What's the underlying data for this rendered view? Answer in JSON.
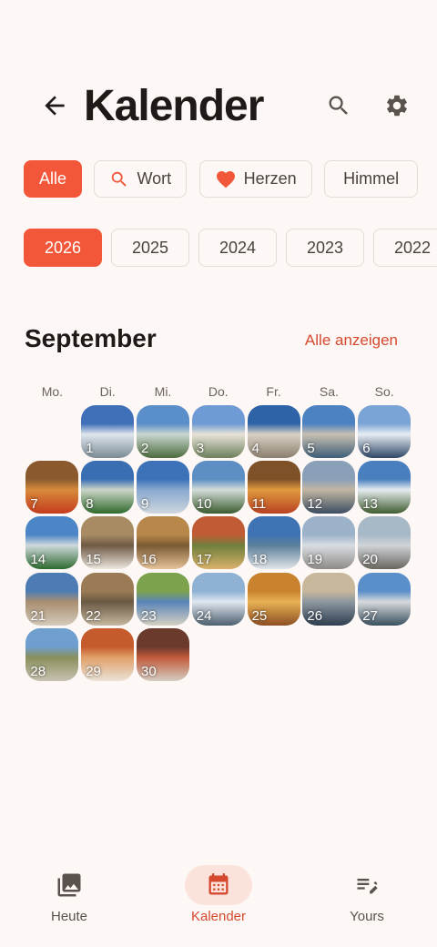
{
  "header": {
    "title": "Kalender"
  },
  "chips": [
    {
      "label": "Alle",
      "active": true,
      "icon": ""
    },
    {
      "label": "Wort",
      "active": false,
      "icon": "search-icon"
    },
    {
      "label": "Herzen",
      "active": false,
      "icon": "heart-icon"
    },
    {
      "label": "Himmel",
      "active": false,
      "icon": ""
    }
  ],
  "years": [
    {
      "label": "2026",
      "active": true
    },
    {
      "label": "2025",
      "active": false
    },
    {
      "label": "2024",
      "active": false
    },
    {
      "label": "2023",
      "active": false
    },
    {
      "label": "2022",
      "active": false
    }
  ],
  "calendar": {
    "month": "September",
    "show_all": "Alle anzeigen",
    "weekdays": [
      "Mo.",
      "Di.",
      "Mi.",
      "Do.",
      "Fr.",
      "Sa.",
      "So."
    ],
    "days": [
      "1",
      "2",
      "3",
      "4",
      "5",
      "6",
      "7",
      "8",
      "9",
      "10",
      "11",
      "12",
      "13",
      "14",
      "15",
      "16",
      "17",
      "18",
      "19",
      "20",
      "21",
      "22",
      "23",
      "24",
      "25",
      "26",
      "27",
      "28",
      "29",
      "30"
    ]
  },
  "nav": {
    "items": [
      {
        "label": "Heute",
        "icon": "photos-icon"
      },
      {
        "label": "Kalender",
        "icon": "calendar-icon"
      },
      {
        "label": "Yours",
        "icon": "edit-list-icon"
      }
    ]
  },
  "colors": {
    "accent": "#f2573a",
    "accent_text": "#d5492f",
    "background": "#fdf8f5"
  }
}
